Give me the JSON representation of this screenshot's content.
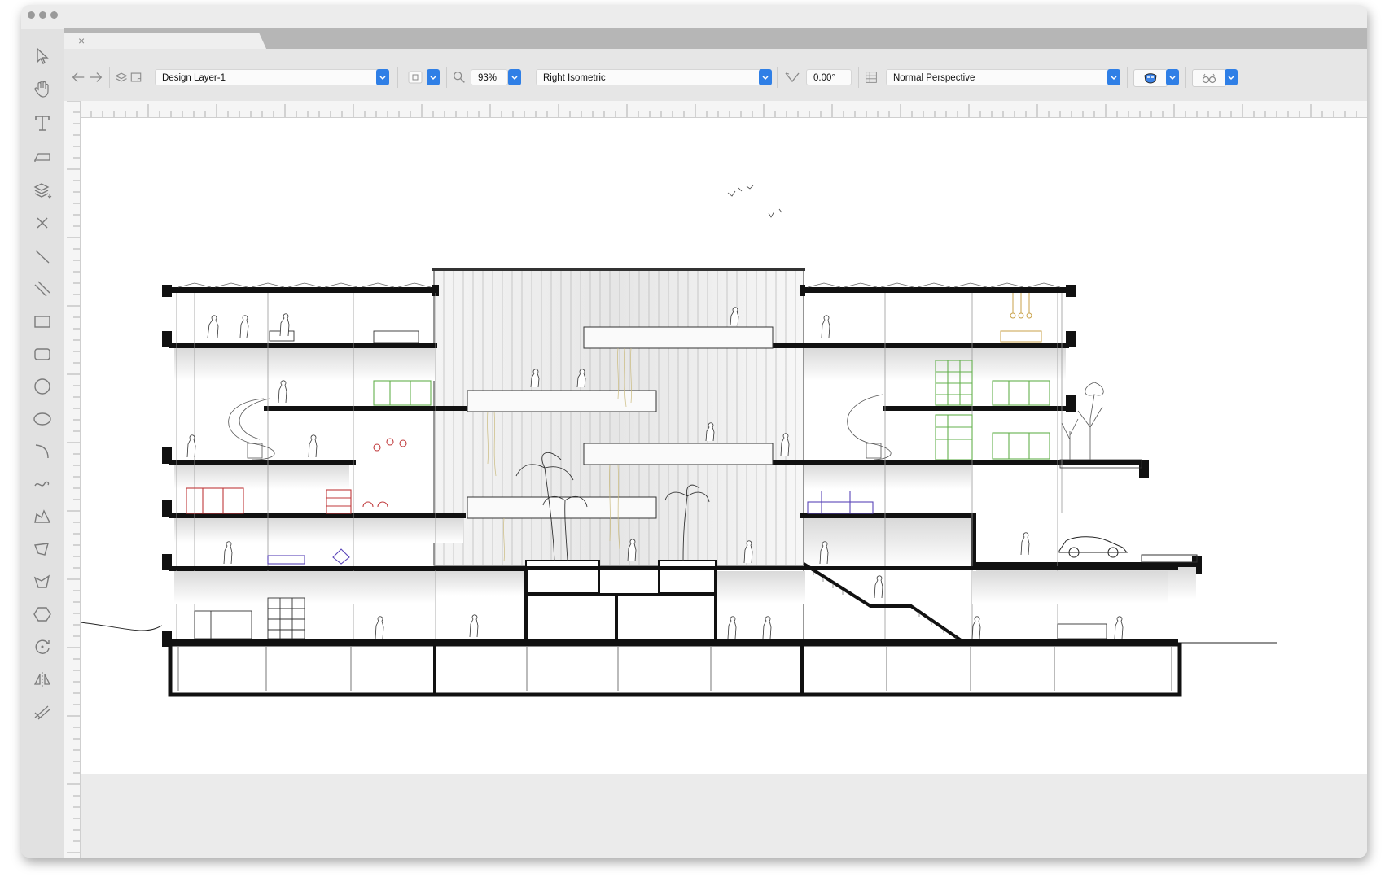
{
  "window": {
    "tab_close_symbol": "×"
  },
  "toolbar": {
    "layer": "Design Layer-1",
    "zoom": "93%",
    "view": "Right Isometric",
    "rotation": "0.00°",
    "projection": "Normal Perspective"
  },
  "icons": {
    "left_toolbar": [
      "selection-arrow-icon",
      "pan-hand-icon",
      "text-tool-icon",
      "flyover-icon",
      "layer-stack-icon",
      "close-x-icon",
      "line-icon",
      "double-line-icon",
      "rectangle-icon",
      "rounded-rectangle-icon",
      "circle-icon",
      "oval-icon",
      "arc-icon",
      "freehand-icon",
      "polyline-icon",
      "polygon-icon",
      "multi-polygon-icon",
      "hexagon-icon",
      "rotate-icon",
      "mirror-icon",
      "dimension-icon"
    ],
    "top_toolbar": [
      "back-arrow-icon",
      "forward-arrow-icon",
      "layer-icon",
      "sheet-icon",
      "render-mode-icon",
      "zoom-icon",
      "angle-icon",
      "grid-icon",
      "mask-icon",
      "glasses-icon"
    ]
  },
  "colors": {
    "accent": "#2f7fe6",
    "furniture_green": "#63b04d",
    "furniture_red": "#c0393b",
    "furniture_purple": "#5a45b8",
    "lamp_gold": "#c9a24a"
  }
}
